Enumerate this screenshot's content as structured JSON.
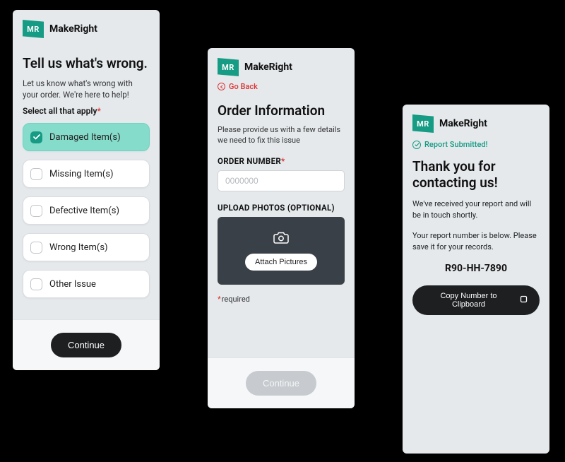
{
  "brand": {
    "mark": "MR",
    "name": "MakeRight"
  },
  "card1": {
    "title": "Tell us what's wrong.",
    "subtitle": "Let us know what's wrong with your order. We're here to help!",
    "select_label": "Select all that apply",
    "options": [
      {
        "label": "Damaged Item(s)",
        "selected": true
      },
      {
        "label": "Missing Item(s)",
        "selected": false
      },
      {
        "label": "Defective Item(s)",
        "selected": false
      },
      {
        "label": "Wrong Item(s)",
        "selected": false
      },
      {
        "label": "Other Issue",
        "selected": false
      }
    ],
    "continue_label": "Continue"
  },
  "card2": {
    "go_back": "Go Back",
    "title": "Order Information",
    "subtitle": "Please provide us with a few details we need to fix this issue",
    "order_number_label": "ORDER NUMBER",
    "order_number_placeholder": "0000000",
    "upload_label": "UPLOAD PHOTOS (OPTIONAL)",
    "attach_label": "Attach Pictures",
    "required_note": "required",
    "continue_label": "Continue"
  },
  "card3": {
    "submitted_label": "Report Submitted!",
    "title": "Thank you for contacting us!",
    "line1": "We've received your report and will be in touch shortly.",
    "line2": "Your report number is below. Please save it for your records.",
    "report_number": "R90-HH-7890",
    "copy_label": "Copy Number to Clipboard"
  }
}
